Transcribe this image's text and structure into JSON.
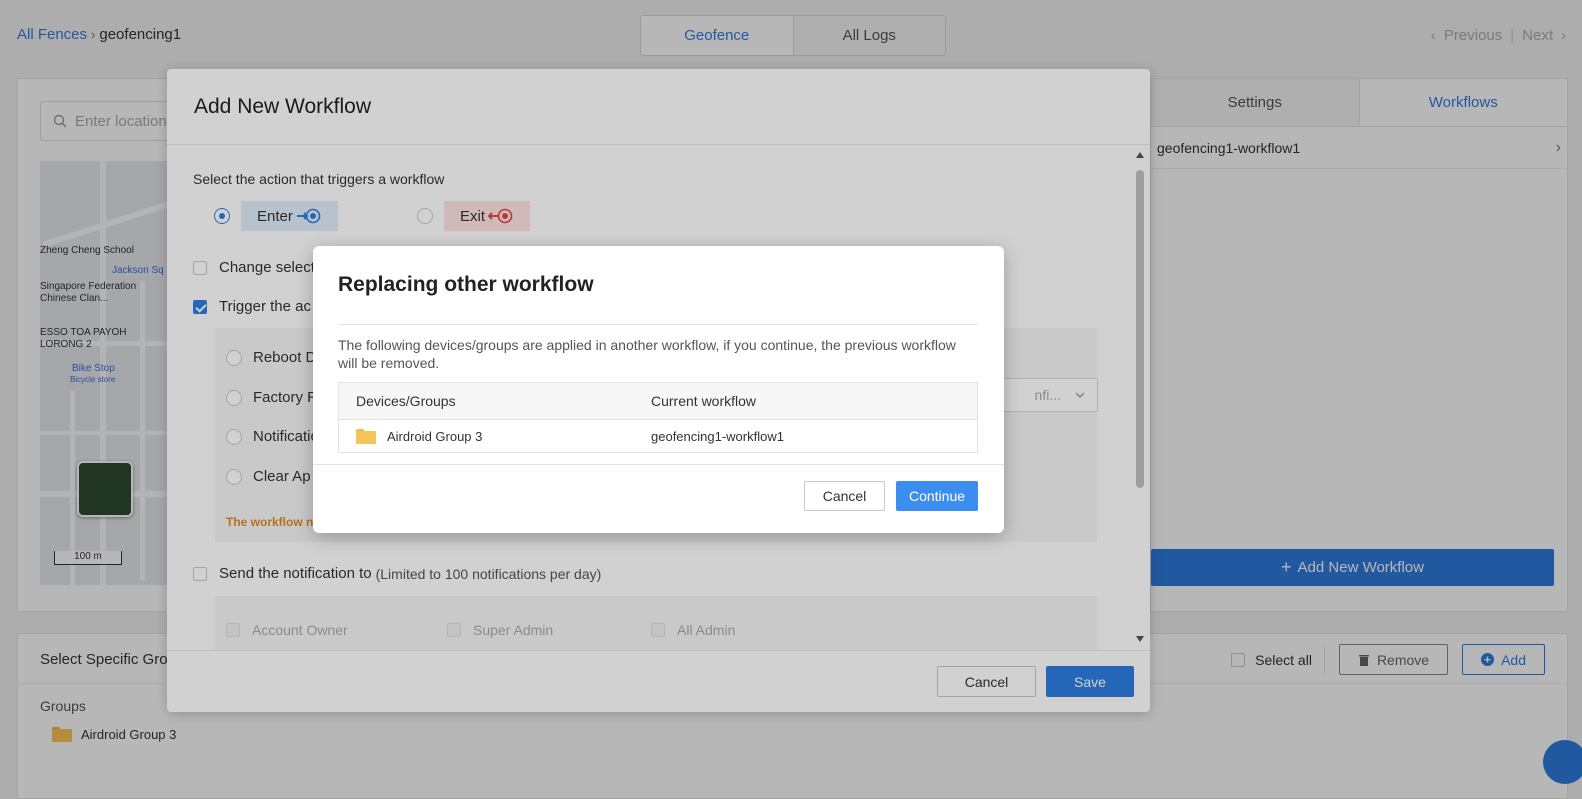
{
  "breadcrumb": {
    "root": "All Fences",
    "current": "geofencing1"
  },
  "top_tabs": {
    "geofence": "Geofence",
    "all_logs": "All Logs"
  },
  "pager": {
    "previous": "Previous",
    "next": "Next"
  },
  "search": {
    "placeholder": "Enter location"
  },
  "map": {
    "labels": [
      "Zheng Cheng School",
      "Jackson Sq",
      "Singapore Federation",
      "Chinese Clan...",
      "ESSO TOA PAYOH",
      "LORONG 2",
      "Bike Stop",
      "Bicycle store"
    ],
    "scale": "100 m"
  },
  "right_panel": {
    "tab_settings": "Settings",
    "tab_workflows": "Workflows",
    "workflow_item": "geofencing1-workflow1",
    "add_button": "Add New Workflow"
  },
  "bottom": {
    "title": "Select Specific Groups",
    "select_all": "Select all",
    "remove": "Remove",
    "add": "Add",
    "groups_label": "Groups",
    "group_item": "Airdroid Group 3"
  },
  "workflow_modal": {
    "title": "Add New Workflow",
    "trigger_label": "Select the action that triggers a workflow",
    "enter": "Enter",
    "exit": "Exit",
    "change_select": "Change select",
    "trigger_action": "Trigger the ac",
    "actions": [
      "Reboot D",
      "Factory R",
      "Notificatio",
      "Clear Ap"
    ],
    "config_text": "nfi...",
    "workflow_note": "The workflow n",
    "send_notification": "Send the notification to",
    "send_notification_limit": "(Limited to 100 notifications per day)",
    "recipients": [
      "Account Owner",
      "Super Admin",
      "All Admin"
    ],
    "cancel": "Cancel",
    "save": "Save"
  },
  "replace_dialog": {
    "title": "Replacing other workflow",
    "message": "The following devices/groups are applied in another workflow, if you continue, the previous workflow will be removed.",
    "col_devices": "Devices/Groups",
    "col_workflow": "Current workflow",
    "row_device": "Airdroid Group 3",
    "row_workflow": "geofencing1-workflow1",
    "cancel": "Cancel",
    "continue": "Continue"
  },
  "colors": {
    "accent": "#2f7de1",
    "warning": "#e08a1e",
    "exit_pill": "#fde2e2",
    "enter_pill": "#e0edfb"
  }
}
